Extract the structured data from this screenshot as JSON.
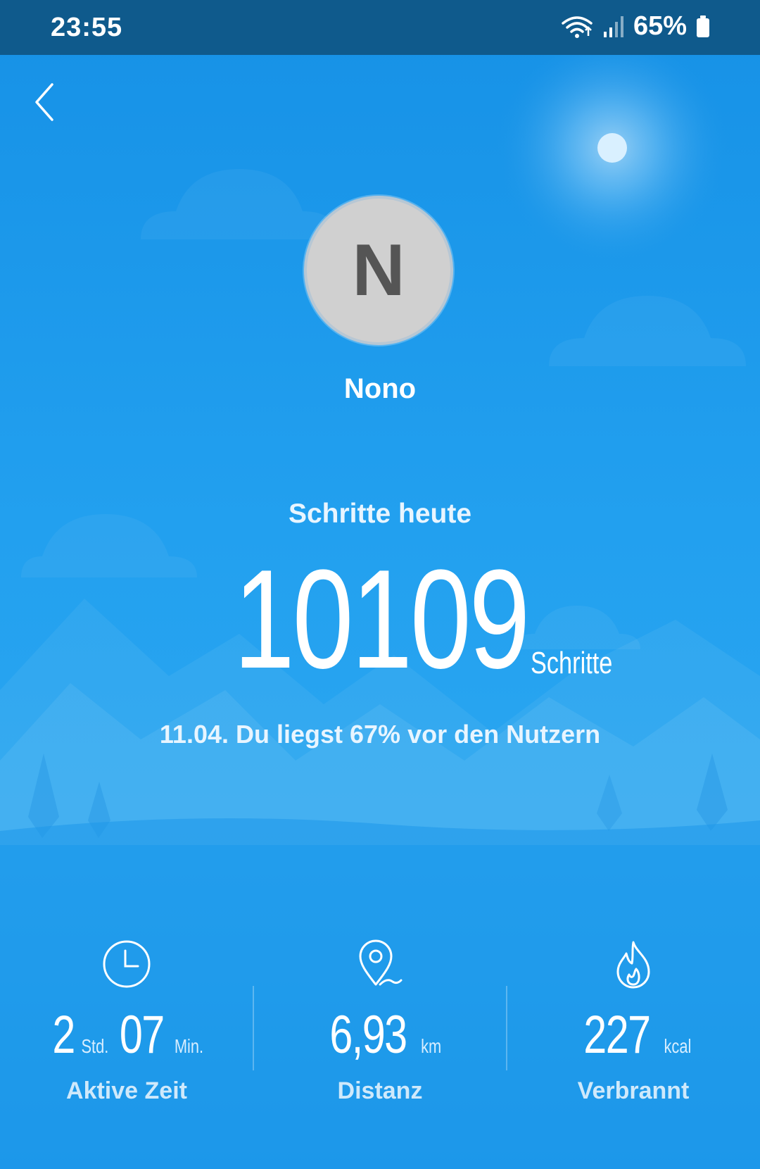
{
  "status_bar": {
    "time": "23:55",
    "battery": "65%"
  },
  "profile": {
    "avatar_initial": "N",
    "name": "Nono"
  },
  "steps": {
    "label": "Schritte heute",
    "value": "10109",
    "unit": "Schritte",
    "comparison": "11.04. Du liegst 67% vor den Nutzern"
  },
  "stats": {
    "active_time": {
      "hours": "2",
      "hours_unit": "Std.",
      "minutes": "07",
      "minutes_unit": "Min.",
      "label": "Aktive Zeit",
      "icon": "clock-icon"
    },
    "distance": {
      "value": "6,93",
      "unit": "km",
      "label": "Distanz",
      "icon": "location-pin-icon"
    },
    "calories": {
      "value": "227",
      "unit": "kcal",
      "label": "Verbrannt",
      "icon": "flame-icon"
    }
  },
  "colors": {
    "status_bar": "#0f5a8c",
    "background": "#22a0ef",
    "avatar": "#d0d0d0"
  }
}
